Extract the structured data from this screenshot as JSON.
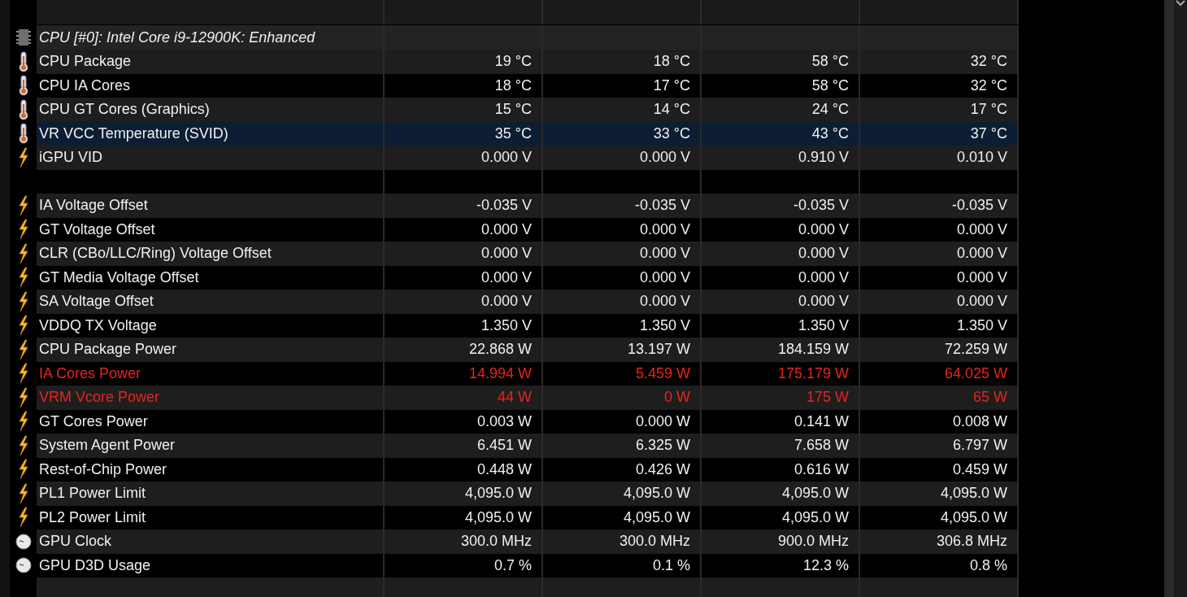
{
  "group": {
    "title": "CPU [#0]: Intel Core i9-12900K: Enhanced"
  },
  "rows": [
    {
      "kind": "temperature",
      "label": "CPU Package",
      "values": [
        "19 °C",
        "18 °C",
        "58 °C",
        "32 °C"
      ],
      "selected": false,
      "alert": false
    },
    {
      "kind": "temperature",
      "label": "CPU IA Cores",
      "values": [
        "18 °C",
        "17 °C",
        "58 °C",
        "32 °C"
      ],
      "selected": false,
      "alert": false
    },
    {
      "kind": "temperature",
      "label": "CPU GT Cores (Graphics)",
      "values": [
        "15 °C",
        "14 °C",
        "24 °C",
        "17 °C"
      ],
      "selected": false,
      "alert": false
    },
    {
      "kind": "temperature",
      "label": "VR VCC Temperature (SVID)",
      "values": [
        "35 °C",
        "33 °C",
        "43 °C",
        "37 °C"
      ],
      "selected": true,
      "alert": false
    },
    {
      "kind": "voltage",
      "label": "iGPU VID",
      "values": [
        "0.000 V",
        "0.000 V",
        "0.910 V",
        "0.010 V"
      ],
      "selected": false,
      "alert": false
    },
    {
      "kind": "blank",
      "selected": false
    },
    {
      "kind": "voltage",
      "label": "IA Voltage Offset",
      "values": [
        "-0.035 V",
        "-0.035 V",
        "-0.035 V",
        "-0.035 V"
      ],
      "selected": false,
      "alert": false
    },
    {
      "kind": "voltage",
      "label": "GT Voltage Offset",
      "values": [
        "0.000 V",
        "0.000 V",
        "0.000 V",
        "0.000 V"
      ],
      "selected": false,
      "alert": false
    },
    {
      "kind": "voltage",
      "label": "CLR (CBo/LLC/Ring) Voltage Offset",
      "values": [
        "0.000 V",
        "0.000 V",
        "0.000 V",
        "0.000 V"
      ],
      "selected": false,
      "alert": false
    },
    {
      "kind": "voltage",
      "label": "GT Media Voltage Offset",
      "values": [
        "0.000 V",
        "0.000 V",
        "0.000 V",
        "0.000 V"
      ],
      "selected": false,
      "alert": false
    },
    {
      "kind": "voltage",
      "label": "SA Voltage Offset",
      "values": [
        "0.000 V",
        "0.000 V",
        "0.000 V",
        "0.000 V"
      ],
      "selected": false,
      "alert": false
    },
    {
      "kind": "voltage",
      "label": "VDDQ TX Voltage",
      "values": [
        "1.350 V",
        "1.350 V",
        "1.350 V",
        "1.350 V"
      ],
      "selected": false,
      "alert": false
    },
    {
      "kind": "voltage",
      "label": "CPU Package Power",
      "values": [
        "22.868 W",
        "13.197 W",
        "184.159 W",
        "72.259 W"
      ],
      "selected": false,
      "alert": false
    },
    {
      "kind": "voltage",
      "label": "IA Cores Power",
      "values": [
        "14.994 W",
        "5.459 W",
        "175.179 W",
        "64.025 W"
      ],
      "selected": false,
      "alert": true
    },
    {
      "kind": "voltage",
      "label": "VRM Vcore Power",
      "values": [
        "44 W",
        "0 W",
        "175 W",
        "65 W"
      ],
      "selected": false,
      "alert": true
    },
    {
      "kind": "voltage",
      "label": "GT Cores Power",
      "values": [
        "0.003 W",
        "0.000 W",
        "0.141 W",
        "0.008 W"
      ],
      "selected": false,
      "alert": false
    },
    {
      "kind": "voltage",
      "label": "System Agent Power",
      "values": [
        "6.451 W",
        "6.325 W",
        "7.658 W",
        "6.797 W"
      ],
      "selected": false,
      "alert": false
    },
    {
      "kind": "voltage",
      "label": "Rest-of-Chip Power",
      "values": [
        "0.448 W",
        "0.426 W",
        "0.616 W",
        "0.459 W"
      ],
      "selected": false,
      "alert": false
    },
    {
      "kind": "voltage",
      "label": "PL1 Power Limit",
      "values": [
        "4,095.0 W",
        "4,095.0 W",
        "4,095.0 W",
        "4,095.0 W"
      ],
      "selected": false,
      "alert": false
    },
    {
      "kind": "voltage",
      "label": "PL2 Power Limit",
      "values": [
        "4,095.0 W",
        "4,095.0 W",
        "4,095.0 W",
        "4,095.0 W"
      ],
      "selected": false,
      "alert": false
    },
    {
      "kind": "clock",
      "label": "GPU Clock",
      "values": [
        "300.0 MHz",
        "300.0 MHz",
        "900.0 MHz",
        "306.8 MHz"
      ],
      "selected": false,
      "alert": false
    },
    {
      "kind": "clock",
      "label": "GPU D3D Usage",
      "values": [
        "0.7 %",
        "0.1 %",
        "12.3 %",
        "0.8 %"
      ],
      "selected": false,
      "alert": false
    },
    {
      "kind": "blank",
      "selected": false
    }
  ]
}
